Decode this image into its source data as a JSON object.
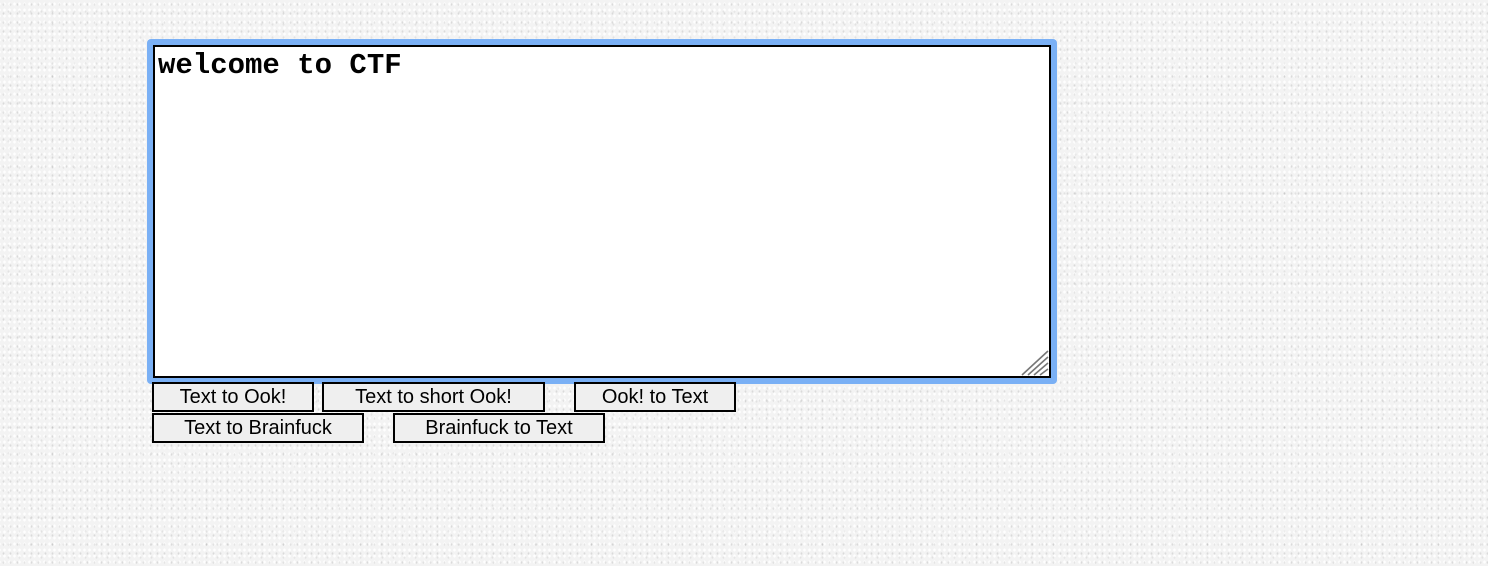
{
  "editor": {
    "value": "welcome to CTF"
  },
  "buttons": {
    "text_to_ook": "Text to Ook!",
    "text_to_short_ook": "Text to short Ook!",
    "ook_to_text": "Ook! to Text",
    "text_to_brainfuck": "Text to Brainfuck",
    "brainfuck_to_text": "Brainfuck to Text"
  },
  "colors": {
    "focus_ring": "#7ab0f5",
    "button_bg": "#efefef",
    "page_bg": "#f3f3f3"
  },
  "icons": {
    "resize_grip": "resize-grip-icon"
  }
}
